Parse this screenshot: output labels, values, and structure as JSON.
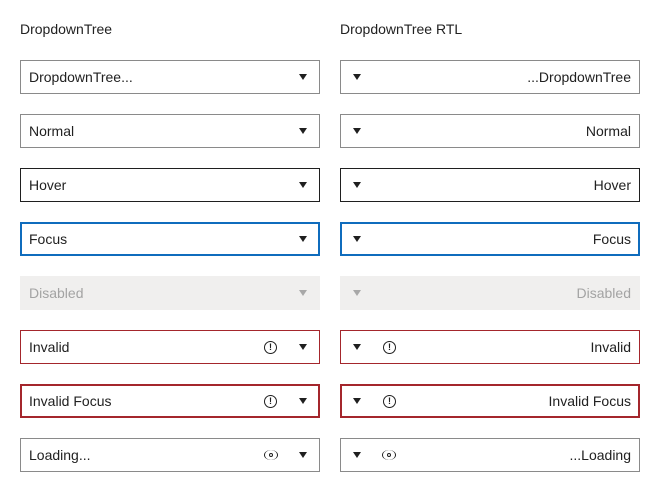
{
  "columns": [
    {
      "id": "ltr",
      "title": "DropdownTree",
      "dropdowns": [
        {
          "text": "DropdownTree..."
        },
        {
          "text": "Normal"
        },
        {
          "text": "Hover"
        },
        {
          "text": "Focus"
        },
        {
          "text": "Disabled"
        },
        {
          "text": "Invalid"
        },
        {
          "text": "Invalid Focus"
        },
        {
          "text": "Loading..."
        }
      ]
    },
    {
      "id": "rtl",
      "title": "DropdownTree RTL",
      "dropdowns": [
        {
          "text": "...DropdownTree"
        },
        {
          "text": "Normal"
        },
        {
          "text": "Hover"
        },
        {
          "text": "Focus"
        },
        {
          "text": "Disabled"
        },
        {
          "text": "Invalid"
        },
        {
          "text": "Invalid Focus"
        },
        {
          "text": "...Loading"
        }
      ]
    }
  ],
  "icons": {
    "caret": "chevron-down-icon",
    "alert": "alert-icon",
    "loading": "loading-icon",
    "alert_glyph": "!"
  },
  "colors": {
    "border": "#8a8a8a",
    "border_hover": "#1f1f1f",
    "focus": "#0f6cbd",
    "invalid": "#a4262c",
    "disabled_bg": "#f0efee",
    "disabled_text": "#a3a3a3"
  }
}
